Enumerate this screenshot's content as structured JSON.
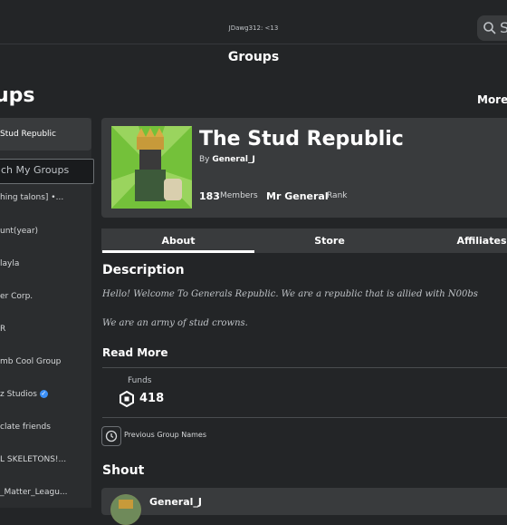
{
  "topbar": {
    "user_label": "JDawg312: <13",
    "search_glyph": "S"
  },
  "nav": {
    "title": "Groups"
  },
  "page": {
    "title": "ups",
    "more_label": "More"
  },
  "sidebar": {
    "active_item": "Stud Republic",
    "search_placeholder": "ch My Groups",
    "items": [
      "hing talons] •...",
      "unt(year)",
      "layla",
      "er Corp.",
      "R",
      "mb Cool Group",
      "z Studios",
      "clate friends",
      "L SKELETONS!...",
      "_Matter_Leagu..."
    ]
  },
  "group": {
    "name": "The Stud Republic",
    "by_prefix": "By",
    "owner": "General_J",
    "members_count": "183",
    "members_label": "Members",
    "rank_value": "Mr General",
    "rank_label": "Rank"
  },
  "tabs": [
    "About",
    "Store",
    "Affiliates"
  ],
  "description": {
    "title": "Description",
    "line1": "Hello! Welcome To Generals Republic. We are a republic that is allied with N00bs",
    "line2": "We are an army of stud crowns.",
    "read_more": "Read More"
  },
  "funds": {
    "label": "Funds",
    "value": "418"
  },
  "history": {
    "label": "Previous Group Names"
  },
  "shout": {
    "title": "Shout",
    "poster": "General_J"
  },
  "colors": {
    "background": "#232527",
    "card": "#393b3d",
    "verified": "#3b8ff6",
    "emblem_green": "#74c13a"
  }
}
